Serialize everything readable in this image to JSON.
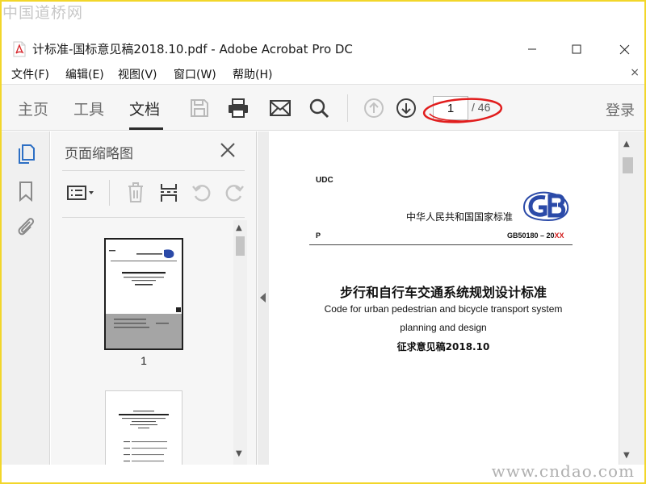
{
  "watermarks": {
    "top": "中国道桥网",
    "bottom": "www.cndao.com"
  },
  "window": {
    "title": "计标准-国标意见稿2018.10.pdf - Adobe Acrobat Pro DC",
    "minimize_icon": "minimize-icon",
    "maximize_icon": "maximize-icon",
    "close_icon": "close-icon"
  },
  "menubar": {
    "items": [
      "文件(F)",
      "编辑(E)",
      "视图(V)",
      "窗口(W)",
      "帮助(H)"
    ],
    "close_glyph": "×"
  },
  "toolbar": {
    "tabs": [
      "主页",
      "工具",
      "文档"
    ],
    "active_tab": "文档",
    "icons": [
      "save-icon",
      "print-icon",
      "email-icon",
      "search-icon",
      "page-up-icon",
      "page-down-icon"
    ],
    "page_current": "1",
    "page_total": "/ 46",
    "login": "登录"
  },
  "left_rail": {
    "icons": [
      "page-thumbnails-icon",
      "bookmark-icon",
      "attachment-icon"
    ]
  },
  "thumbnail_panel": {
    "title": "页面缩略图",
    "tools": [
      "options-menu-icon",
      "delete-icon",
      "insert-pages-icon",
      "undo-icon",
      "redo-icon"
    ],
    "thumbnails": [
      {
        "label": "1",
        "selected": true
      },
      {
        "label": "",
        "selected": false
      }
    ]
  },
  "document": {
    "udc": "UDC",
    "standard_line": "中华人民共和国国家标准",
    "logo": "GB",
    "p_mark": "P",
    "code_prefix": "GB50180 – 20",
    "code_suffix": "XX",
    "title_cn": "步行和自行车交通系统规划设计标准",
    "title_en_line1": "Code for urban pedestrian and bicycle transport system",
    "title_en_line2": "planning and design",
    "draft_note": "征求意见稿2018.10"
  },
  "colors": {
    "frame_border": "#f2d62a",
    "annotation_ellipse": "#e11d1d",
    "accent_blue": "#2d6fc4",
    "gb_logo_blue": "#2b4aa8"
  }
}
